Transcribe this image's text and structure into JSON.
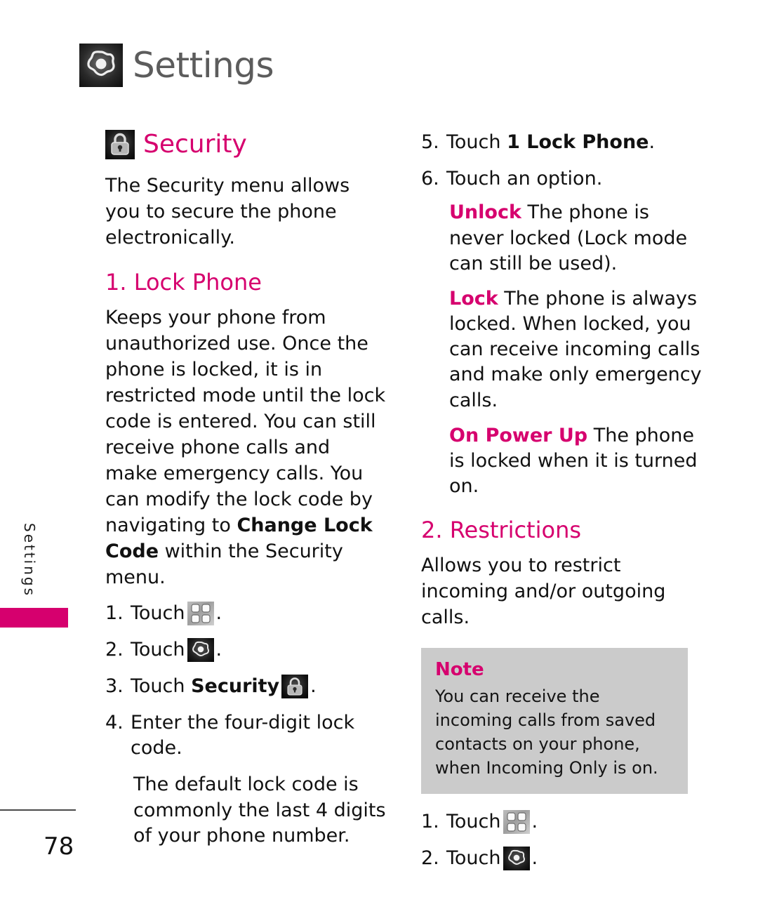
{
  "header": {
    "title": "Settings",
    "icon": "settings-flower-icon"
  },
  "side_tab": {
    "label": "Settings"
  },
  "section": {
    "icon": "padlock-icon",
    "title": "Security",
    "intro": "The Security menu allows you to secure the phone electronically."
  },
  "lock_phone": {
    "heading": "1. Lock Phone",
    "paragraph_1": "Keeps your phone from unauthorized use. Once the phone is locked, it is in restricted mode until the lock code is entered. You can still receive phone calls and make emergency calls. You can modify the lock code by navigating to ",
    "paragraph_1_bold": "Change Lock Code",
    "paragraph_1_tail": " within the Security menu.",
    "steps": [
      {
        "num": "1.",
        "text": "Touch",
        "icon": "grid-menu-icon",
        "tail": "."
      },
      {
        "num": "2.",
        "text": "Touch",
        "icon": "settings-flower-icon",
        "tail": "."
      },
      {
        "num": "3.",
        "text": "Touch",
        "bold": "Security",
        "icon": "padlock-icon",
        "tail": "."
      },
      {
        "num": "4.",
        "text": "Enter the four-digit lock code."
      }
    ],
    "step4_note": "The default lock code is commonly the last 4 digits of your phone number.",
    "step5": {
      "num": "5.",
      "text": "Touch ",
      "bold": "1 Lock Phone",
      "tail": "."
    },
    "step6": {
      "num": "6.",
      "text": "Touch an option."
    },
    "options": [
      {
        "term": "Unlock",
        "desc": " The phone is never locked (Lock mode can still be used)."
      },
      {
        "term": "Lock",
        "desc": " The phone is always locked. When locked, you can receive incoming calls and make only emergency calls."
      },
      {
        "term": "On Power Up",
        "desc": " The phone is locked when it is turned on."
      }
    ]
  },
  "restrictions": {
    "heading": "2. Restrictions",
    "paragraph": "Allows you to restrict incoming and/or outgoing calls.",
    "note": {
      "title": "Note",
      "text": "You can receive the incoming calls from saved contacts on your phone, when Incoming Only is on."
    },
    "steps": [
      {
        "num": "1.",
        "text": "Touch",
        "icon": "grid-menu-icon",
        "tail": "."
      },
      {
        "num": "2.",
        "text": "Touch",
        "icon": "settings-flower-icon",
        "tail": "."
      }
    ]
  },
  "footer": {
    "page_number": "78"
  },
  "colors": {
    "accent_pink": "#d6006e",
    "header_gray": "#5c5c5c",
    "note_bg": "#cbcbcb",
    "body_text": "#111111"
  }
}
